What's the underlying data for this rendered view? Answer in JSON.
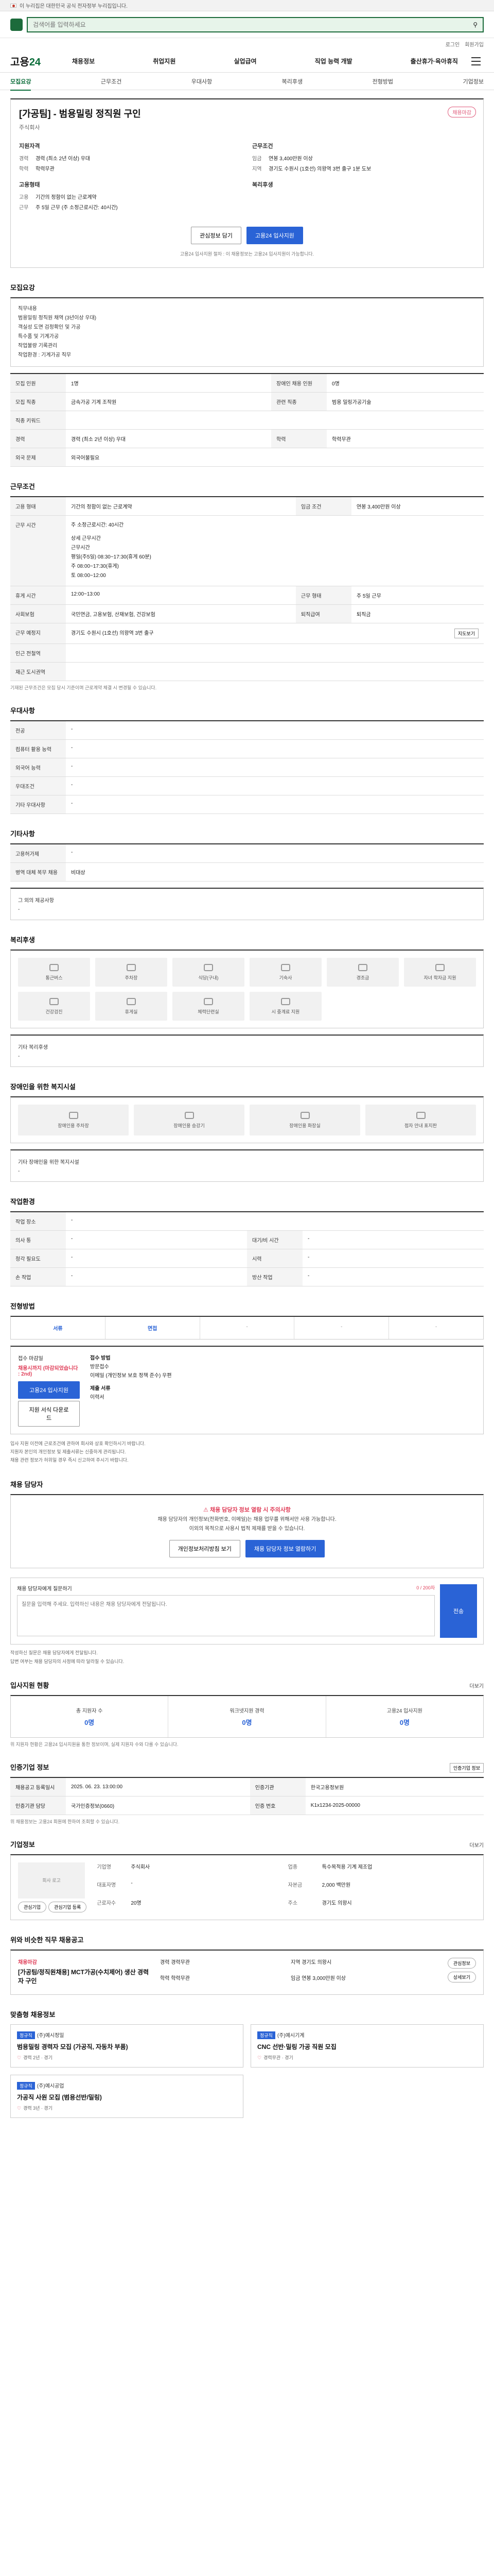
{
  "gov_banner": "이 누리집은 대한민국 공식 전자정부 누리집입니다.",
  "search": {
    "placeholder": "검색어를 입력하세요"
  },
  "util_links": [
    "로그인",
    "회원가입"
  ],
  "gnb": {
    "brand_main": "고용",
    "brand_sub": "24",
    "menu": [
      "채용정보",
      "취업지원",
      "실업급여",
      "직업 능력 개발",
      "출산휴가·육아휴직"
    ]
  },
  "subnav": [
    "모집요강",
    "근무조건",
    "우대사항",
    "복리후생",
    "전형방법",
    "기업정보"
  ],
  "job": {
    "title": "[가공팀] - 범용밀링 정직원 구인",
    "badge": "채용마감",
    "company": "주식회사",
    "qual_head": "지원자격",
    "qual": [
      {
        "k": "경력",
        "v": "경력 (최소 2년 이상) 우대"
      },
      {
        "k": "학력",
        "v": "학력무관"
      }
    ],
    "work_head": "근무조건",
    "work": [
      {
        "k": "임금",
        "v": "연봉 3,400만원 이상"
      },
      {
        "k": "지역",
        "v": "경기도 수원시 (1호선) 의왕역 3번 출구 1분 도보"
      }
    ],
    "emp_head": "고용형태",
    "emp": [
      {
        "k": "고용",
        "v": "기간의 정함이 없는 근로계약"
      },
      {
        "k": "근무",
        "v": "주 5일 근무 (주 소정근로시간: 40시간)"
      }
    ],
    "welfare_head": "복리후생",
    "btn_scrap": "관심정보 담기",
    "btn_apply": "고용24 입사지원",
    "note": "고용24 입사지원 절차 : 이 채용정보는 고용24 입사지원이 가능합니다."
  },
  "recruit": {
    "heading": "모집요강",
    "desc": [
      "직무내용",
      "범용밀링 정직원 채역 (3년이상 우대)",
      "객실성 도면 검정확인 및 가공",
      "특수품 및 기계가공",
      "작업불량 기록관리",
      "작업환경 : 기계가공 직무"
    ],
    "rows": [
      {
        "k": "모집 인원",
        "v": "1명",
        "k2": "장애인 채용 인원",
        "v2": "0명"
      },
      {
        "k": "모집 직종",
        "v": "금속가공 기계 조작원",
        "k2": "관련 직종",
        "v2": "범용 밀링가공기술"
      },
      {
        "k": "직종 키워드",
        "v": ""
      },
      {
        "k": "경력",
        "v": "경력 (최소 2년 이상) 우대",
        "k2": "학력",
        "v2": "학력무관"
      },
      {
        "k": "외국 문제",
        "v": "외국어불필요"
      }
    ]
  },
  "conditions": {
    "heading": "근무조건",
    "rows": [
      {
        "k": "고용 형태",
        "v": "기간의 정함이 없는 근로계약",
        "k2": "임금 조건",
        "v2": "연봉 3,400만원 이상"
      },
      {
        "k": "근무 시간",
        "v": "주 소정근로시간: 40시간",
        "lines": [
          "상세 근무시간",
          "근무시간",
          "평일(주5일) 08:30~17:30(휴게 60분)",
          "주     08:00~17:30(휴게)",
          "토     08:00~12:00"
        ]
      },
      {
        "k": "휴게 시간",
        "v": "12:00~13:00",
        "k2": "근무 형태",
        "v2": "주 5일 근무"
      },
      {
        "k": "사회보험",
        "v": "국민연금, 고용보험, 산재보험, 건강보험",
        "k2": "퇴직급여",
        "v2": "퇴직금"
      },
      {
        "k": "근무 예정지",
        "v": "경기도 수원시 (1호선) 의왕역 3번 출구",
        "k2": "지도보기",
        "v2": ""
      },
      {
        "k": "인근 전철역",
        "v": ""
      },
      {
        "k": "재근 도시권역",
        "v": ""
      }
    ],
    "note": "기재된 근무조건은 모집 당시 기준이며 근로계약 체결 시 변경될 수 있습니다."
  },
  "preferred": {
    "heading": "우대사항",
    "rows": [
      {
        "k": "전공",
        "v": "-"
      },
      {
        "k": "컴퓨터 활용 능력",
        "v": "-"
      },
      {
        "k": "외국어 능력",
        "v": "-"
      },
      {
        "k": "우대조건",
        "v": "-"
      },
      {
        "k": "기타 우대사항",
        "v": "-"
      }
    ]
  },
  "other": {
    "heading": "기타사항",
    "rows": [
      {
        "k": "고용허가제",
        "v": "-"
      },
      {
        "k": "병역 대체 복무 채용",
        "v": "비대상"
      }
    ],
    "extra_title": "그 외의 제공사항",
    "extra_value": "-"
  },
  "welfare": {
    "heading": "복리후생",
    "items": [
      "통근버스",
      "주차장",
      "식당(구내)",
      "기숙사",
      "경조금",
      "자녀 학자금 지원",
      "건강검진",
      "휴게실",
      "체력단련실",
      "시 중계료 지원"
    ],
    "extra_title": "기타 복리후생",
    "extra_value": "-"
  },
  "disability": {
    "heading": "장애인을 위한 복지시설",
    "items": [
      "장애인용 주차장",
      "장애인용 승강기",
      "장애인용 화장실",
      "점자 안내 표지판"
    ],
    "extra_title": "기타 장애인을 위한 복지시설",
    "extra_value": "-"
  },
  "environment": {
    "heading": "작업환경",
    "rows": [
      {
        "k": "작업 장소",
        "v": "-"
      },
      {
        "k": "의사 통",
        "v": "-",
        "k2": "대기/비 시간",
        "v2": "-"
      },
      {
        "k": "청각 필요도",
        "v": "-",
        "k2": "시력",
        "v2": "-"
      },
      {
        "k": "손 작업",
        "v": "-",
        "k2": "방산 작업",
        "v2": "-"
      }
    ]
  },
  "selection": {
    "heading": "전형방법",
    "steps": [
      "서류",
      "면접",
      "-",
      "-",
      "-"
    ],
    "apply_title": "접수 마감일",
    "deadline": "채용시까지 (마감되었습니다 : 2nd)",
    "btn_apply": "고용24 입사지원",
    "btn_form": "지원 서식 다운로드",
    "method_title": "접수 방법",
    "methods": [
      "방문접수",
      "이메일 (개인정보 보호 정책 준수) 우편"
    ],
    "docs_title": "제출 서류",
    "docs": [
      "이력서"
    ],
    "warns": [
      "입사 지원 이전에 근로조건에 관하여 회사와 상호 확인하시기 바랍니다.",
      "지원자 본인의 개인정보 및 제출서류는 신중하게 관리됩니다.",
      "채용 관련 정보가 허위일 경우 즉시 신고하여 주시기 바랍니다."
    ]
  },
  "contact": {
    "heading": "채용 담당자",
    "alert_title": "채용 담당자 정보 열람 시 주의사항",
    "alert_lines": [
      "채용 담당자의 개인정보(전화번호, 이메일)는 채용 업무를 위해서만 사용 가능합니다.",
      "이외의 목적으로 사용시 법적 제재를 받을 수 있습니다."
    ],
    "btn_info": "개인정보처리방침 보기",
    "btn_view": "채용 담당자 정보 열람하기",
    "inquiry_title": "채용 담당자에게 질문하기",
    "inquiry_count": "0 / 200자",
    "inquiry_placeholder": "질문을 입력해 주세요. 입력하신 내용은 채용 담당자에게 전달됩니다.",
    "btn_send": "전송",
    "inquiry_notes": [
      "작성하신 질문은 채용 담당자에게 전달됩니다.",
      "답변 여부는 채용 담당자의 사정에 따라 달라질 수 있습니다."
    ]
  },
  "stats": {
    "heading": "입사지원 현황",
    "more": "더보기",
    "items": [
      {
        "label": "총 지원자 수",
        "value": "0명"
      },
      {
        "label": "워크넷지원 경력",
        "value": "0명"
      },
      {
        "label": "고용24 입사지원",
        "value": "0명"
      }
    ],
    "note": "위 지원자 현황은 고용24 입사지원을 통한 정보이며, 실제 지원자 수와 다를 수 있습니다."
  },
  "info": {
    "heading": "인증기업 정보",
    "btn": "인증기업 정보",
    "rows": [
      {
        "k": "채용공고 등록일시",
        "v": "2025. 06. 23. 13:00:00",
        "k2": "인증기관",
        "v2": "한국고용정보원"
      },
      {
        "k": "인증기관 담당",
        "v": "국가인증정보(0660)",
        "k2": "인증 번호",
        "v2": "K1x1234-2025-00000"
      }
    ],
    "notes": [
      "위 채용정보는 고용24 회원에 한하여 조회할 수 있습니다."
    ]
  },
  "company": {
    "heading": "기업정보",
    "more": "더보기",
    "logo": "회사 로고",
    "btn_scrap": "관심기업",
    "btn_follow": "관심기업 등록",
    "meta": [
      {
        "k": "기업명",
        "v": "주식회사"
      },
      {
        "k": "업종",
        "v": "특수목적용 기계 제조업"
      },
      {
        "k": "대표자명",
        "v": "-"
      },
      {
        "k": "자본금",
        "v": "2,000 백만원"
      },
      {
        "k": "근로자수",
        "v": "20명"
      },
      {
        "k": "주소",
        "v": "경기도 의왕시"
      }
    ]
  },
  "similar": {
    "heading": "위와 비슷한 직무 채용공고",
    "title_tag": "채용마감",
    "title": "[가공팀/정직원채용] MCT가공(수치제어) 생산 경력자 구인",
    "cols": [
      {
        "k": "경력",
        "v": "경력무관"
      },
      {
        "k": "지역",
        "v": "경기도 의왕시"
      },
      {
        "k": "학력",
        "v": "학력무관"
      },
      {
        "k": "임금",
        "v": "연봉 3,000만원 이상"
      }
    ],
    "btn_scrap": "관심정보",
    "btn_view": "상세보기"
  },
  "recommend": {
    "heading": "맞춤형 채용정보",
    "cards": [
      {
        "tag": "정규직",
        "co": "(주)예시정밀",
        "title": "범용밀링 경력자 모집 (가공직, 자동차 부품)",
        "meta": "경력 2년 · 경기"
      },
      {
        "tag": "정규직",
        "co": "(주)예시기계",
        "title": "CNC 선반·밀링 가공 직원 모집",
        "meta": "경력무관 · 경기"
      },
      {
        "tag": "정규직",
        "co": "(주)예시공업",
        "title": "가공직 사원 모집 (범용선반/밀링)",
        "meta": "경력 3년 · 경기"
      }
    ]
  }
}
